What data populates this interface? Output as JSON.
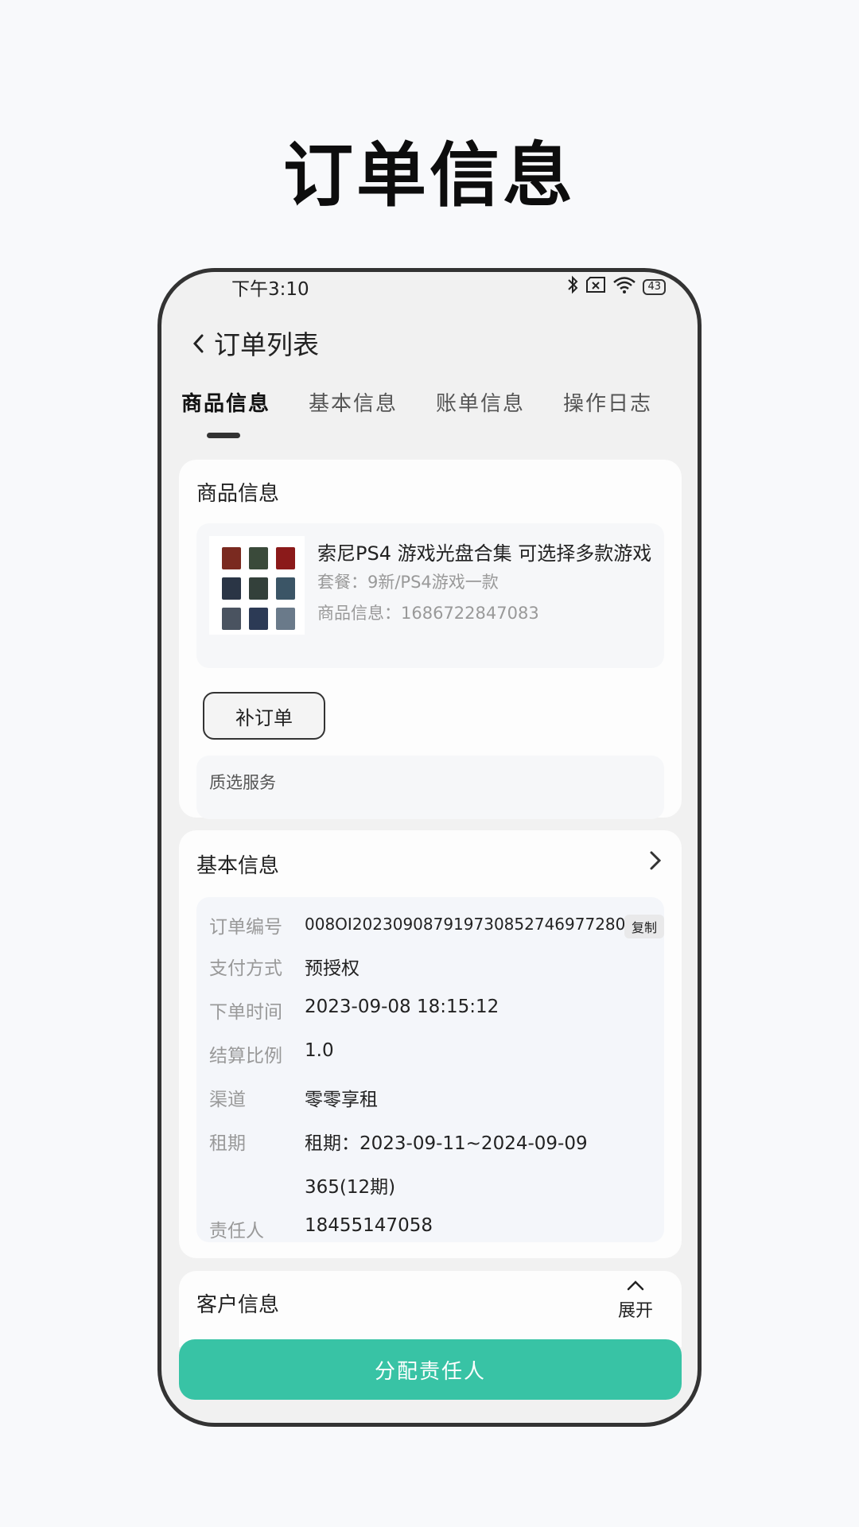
{
  "promo": {
    "title": "订单信息"
  },
  "status_bar": {
    "time": "下午3:10",
    "battery": "43",
    "icons": [
      "bluetooth-icon",
      "sim-x-icon",
      "wifi-icon",
      "battery-icon"
    ]
  },
  "nav": {
    "back_icon": "chevron-left-icon",
    "title": "订单列表"
  },
  "tabs": [
    {
      "label": "商品信息",
      "active": true
    },
    {
      "label": "基本信息",
      "active": false
    },
    {
      "label": "账单信息",
      "active": false
    },
    {
      "label": "操作日志",
      "active": false
    }
  ],
  "product_section": {
    "title": "商品信息",
    "product": {
      "name": "索尼PS4 游戏光盘合集 可选择多款游戏",
      "package": "套餐：9新/PS4游戏一款",
      "info": "商品信息：1686722847083"
    },
    "supplement_button": "补订单",
    "service_label": "质选服务"
  },
  "basic_section": {
    "title": "基本信息",
    "copy_label": "复制",
    "rows": [
      {
        "label": "订单编号",
        "value": "008OI202309087919730852746977280"
      },
      {
        "label": "支付方式",
        "value": "预授权"
      },
      {
        "label": "下单时间",
        "value": "2023-09-08 18:15:12"
      },
      {
        "label": "结算比例",
        "value": "1.0"
      },
      {
        "label": "渠道",
        "value": "零零享租"
      },
      {
        "label": "租期",
        "value": "租期：2023-09-11~2024-09-09"
      },
      {
        "label": "",
        "value": "365(12期)"
      },
      {
        "label": "责任人",
        "value": "18455147058"
      }
    ]
  },
  "customer_section": {
    "title": "客户信息",
    "expand_label": "展开"
  },
  "bottom_button": {
    "label": "分配责任人"
  },
  "colors": {
    "accent": "#38c3a5",
    "page_bg": "#f8f9fb",
    "phone_bg": "#f1f1f1"
  }
}
